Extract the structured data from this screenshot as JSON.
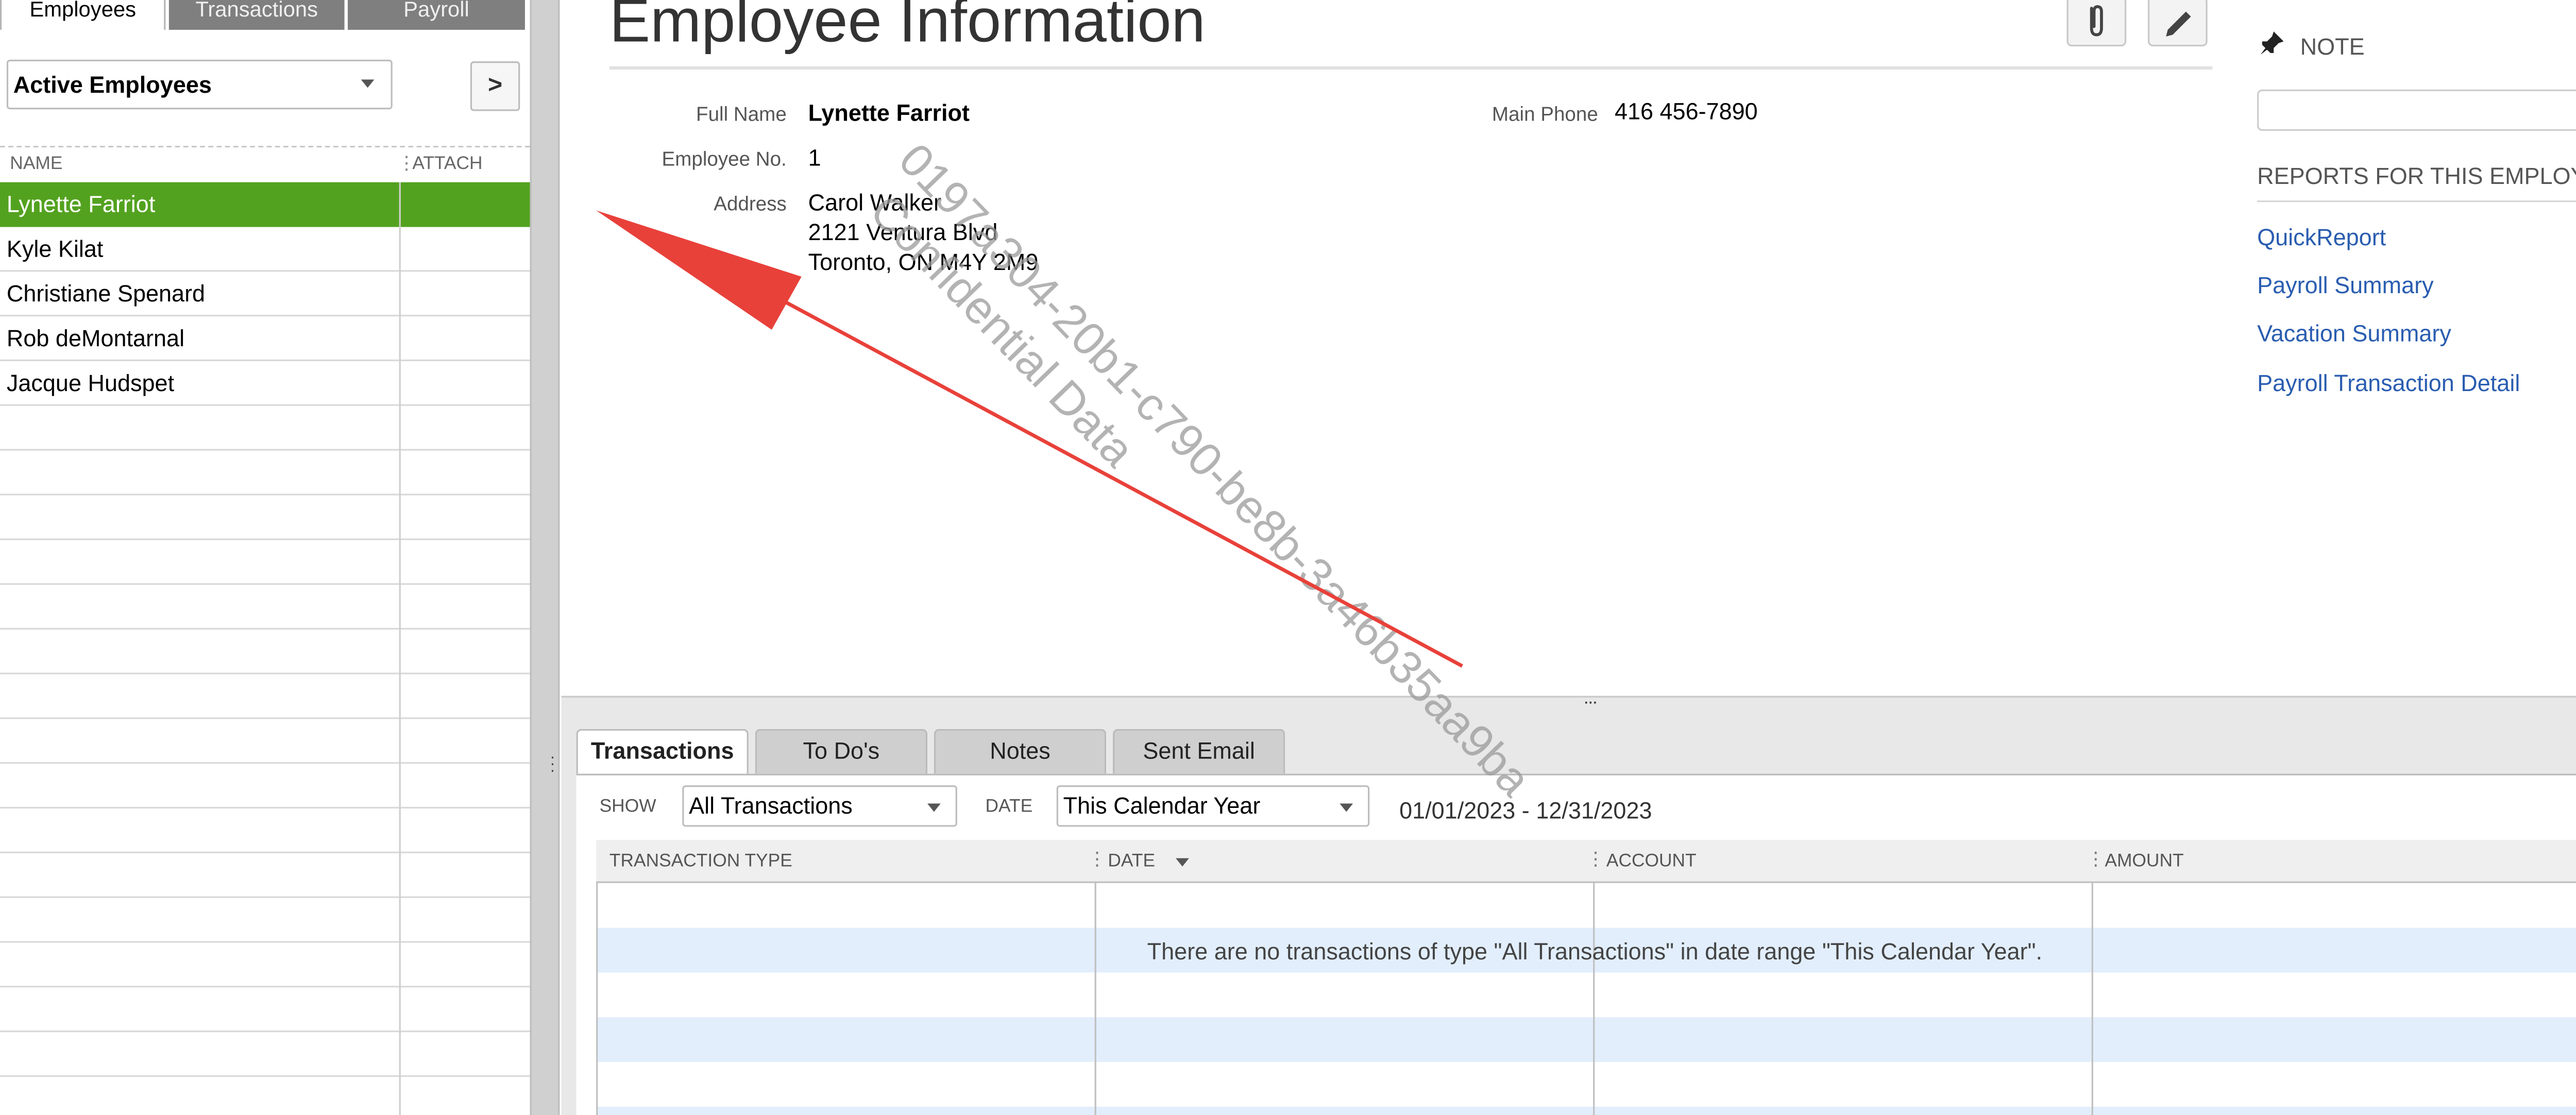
{
  "left_tabs": [
    {
      "label": "Employees"
    },
    {
      "label": "Transactions"
    },
    {
      "label": "Payroll"
    }
  ],
  "filter": {
    "value": "Active Employees",
    "arrow_label": ">"
  },
  "list": {
    "col_name": "NAME",
    "col_attach": "ATTACH",
    "employees": [
      "Lynette Farriot",
      "Kyle Kilat",
      "Christiane Spenard",
      "Rob deMontarnal",
      "Jacque Hudspet"
    ],
    "selected_index": 0
  },
  "info": {
    "title": "Employee Information",
    "full_name_label": "Full Name",
    "full_name": "Lynette Farriot",
    "employee_no_label": "Employee No.",
    "employee_no": "1",
    "address_label": "Address",
    "address_lines": [
      "Carol Walker",
      "2121 Ventura Blvd",
      "Toronto, ON M4Y 2M9"
    ],
    "main_phone_label": "Main Phone",
    "main_phone": "416 456-7890"
  },
  "side": {
    "note_label": "NOTE",
    "reports_title": "REPORTS FOR THIS EMPLOYEE",
    "reports": [
      "QuickReport",
      "Payroll Summary",
      "Vacation Summary",
      "Payroll Transaction Detail"
    ]
  },
  "watermark": {
    "line1": "0197a304-20b1-c790-be8b-3a46b35aa9ba",
    "line2": "Confidential Data"
  },
  "bottom_tabs": [
    {
      "label": "Transactions"
    },
    {
      "label": "To Do's"
    },
    {
      "label": "Notes"
    },
    {
      "label": "Sent Email"
    }
  ],
  "filters": {
    "show_label": "SHOW",
    "show_value": "All Transactions",
    "date_label": "DATE",
    "date_value": "This Calendar Year",
    "date_range": "01/01/2023 - 12/31/2023"
  },
  "table": {
    "columns": [
      "TRANSACTION TYPE",
      "DATE",
      "ACCOUNT",
      "AMOUNT"
    ],
    "empty_message": "There are no transactions of type \"All Transactions\" in date range \"This Calendar Year\"."
  },
  "colors": {
    "selected_row": "#53a21f",
    "link": "#2a5db0",
    "arrow": "#e8413a",
    "alt_row": "#e2eefc"
  }
}
